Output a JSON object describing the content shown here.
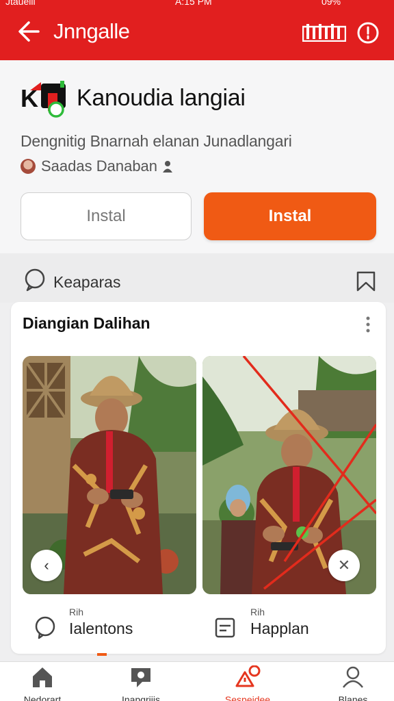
{
  "status_bar": {
    "carrier": "Jtauelii",
    "time": "A:15 PM",
    "battery": "09%"
  },
  "appbar": {
    "title": "Jnngalle",
    "back_icon": "arrow-left-icon",
    "bars_icon": "bar-graph-icon",
    "info_icon": "info-icon"
  },
  "app": {
    "name": "Kanoudia langiai",
    "description": "Dengnitig Bnarnah elanan Junadlangari",
    "developer": "Saadas Danaban"
  },
  "buttons": {
    "secondary": "Instal",
    "primary": "Instal"
  },
  "section": {
    "label": "Keaparas"
  },
  "card": {
    "title": "Diangian Dalihan",
    "actions": [
      {
        "small": "Rih",
        "label": "Ialentons",
        "icon": "chat-bubble-icon"
      },
      {
        "small": "Rih",
        "label": "Happlan",
        "icon": "document-icon"
      }
    ]
  },
  "tabs": [
    {
      "label": "Nedorart",
      "icon": "home-icon"
    },
    {
      "label": "Inapgriiis",
      "icon": "chat-icon"
    },
    {
      "label": "Sespeidee",
      "icon": "alert-icon",
      "active": true
    },
    {
      "label": "Blanes",
      "icon": "profile-icon"
    }
  ],
  "colors": {
    "appbar": "#e11f1f",
    "primary": "#f05a14",
    "active_tab": "#e5361f"
  }
}
